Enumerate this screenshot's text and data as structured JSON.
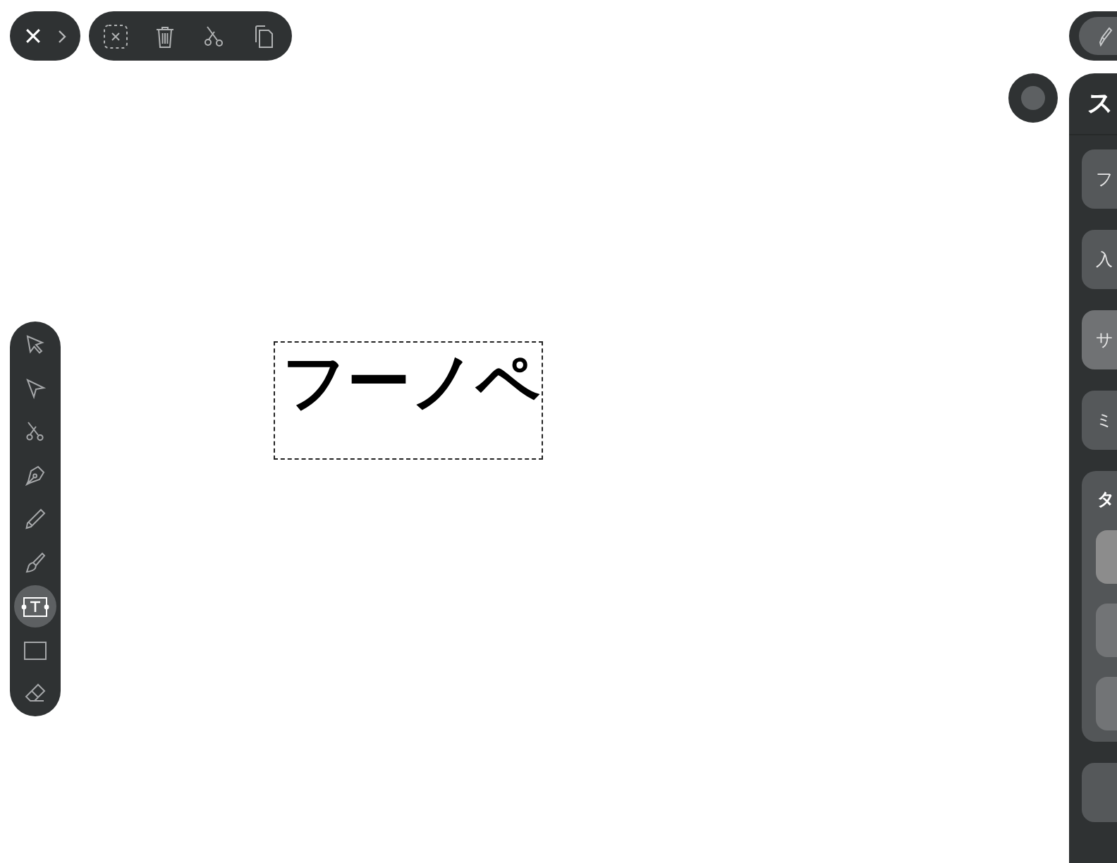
{
  "canvas": {
    "text": "フーノペ"
  },
  "tool_palette": {
    "tools": [
      {
        "kind": "pointer",
        "selected": false
      },
      {
        "kind": "direct",
        "selected": false
      },
      {
        "kind": "scissors",
        "selected": false
      },
      {
        "kind": "pen",
        "selected": false
      },
      {
        "kind": "pencil",
        "selected": false
      },
      {
        "kind": "brush",
        "selected": false
      },
      {
        "kind": "text",
        "selected": true
      },
      {
        "kind": "rectangle",
        "selected": false
      },
      {
        "kind": "eraser",
        "selected": false
      }
    ]
  },
  "panel": {
    "title": "ス",
    "buttons": [
      {
        "label": "フ",
        "selected": false
      },
      {
        "label": "入",
        "selected": false
      },
      {
        "label": "サ",
        "selected": true
      },
      {
        "label": "ミ",
        "selected": false
      }
    ],
    "section": {
      "label": "タ",
      "options": [
        {
          "selected": true
        },
        {
          "selected": false
        },
        {
          "selected": false
        }
      ]
    }
  }
}
